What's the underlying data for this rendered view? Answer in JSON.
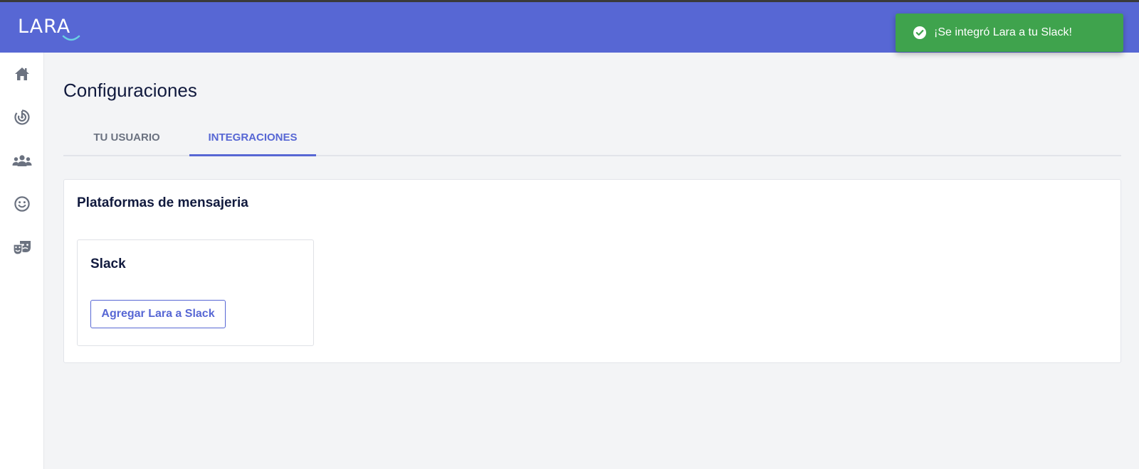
{
  "brand": {
    "logo_text": "LARA",
    "accent_color": "#5767d4",
    "logo_smile_color": "#6ad1e3"
  },
  "toast": {
    "message": "¡Se integró Lara a tu Slack!",
    "icon": "check-circle-icon",
    "color": "#3fa34d"
  },
  "sidebar": {
    "items": [
      {
        "icon": "home-icon"
      },
      {
        "icon": "target-icon"
      },
      {
        "icon": "users-icon"
      },
      {
        "icon": "smiley-icon"
      },
      {
        "icon": "theater-masks-icon"
      }
    ]
  },
  "page": {
    "title": "Configuraciones"
  },
  "tabs": [
    {
      "label": "TU USUARIO",
      "active": false
    },
    {
      "label": "INTEGRACIONES",
      "active": true
    }
  ],
  "integrations": {
    "section_title": "Plataformas de mensajeria",
    "cards": [
      {
        "title": "Slack",
        "button_label": "Agregar Lara a Slack"
      }
    ]
  }
}
